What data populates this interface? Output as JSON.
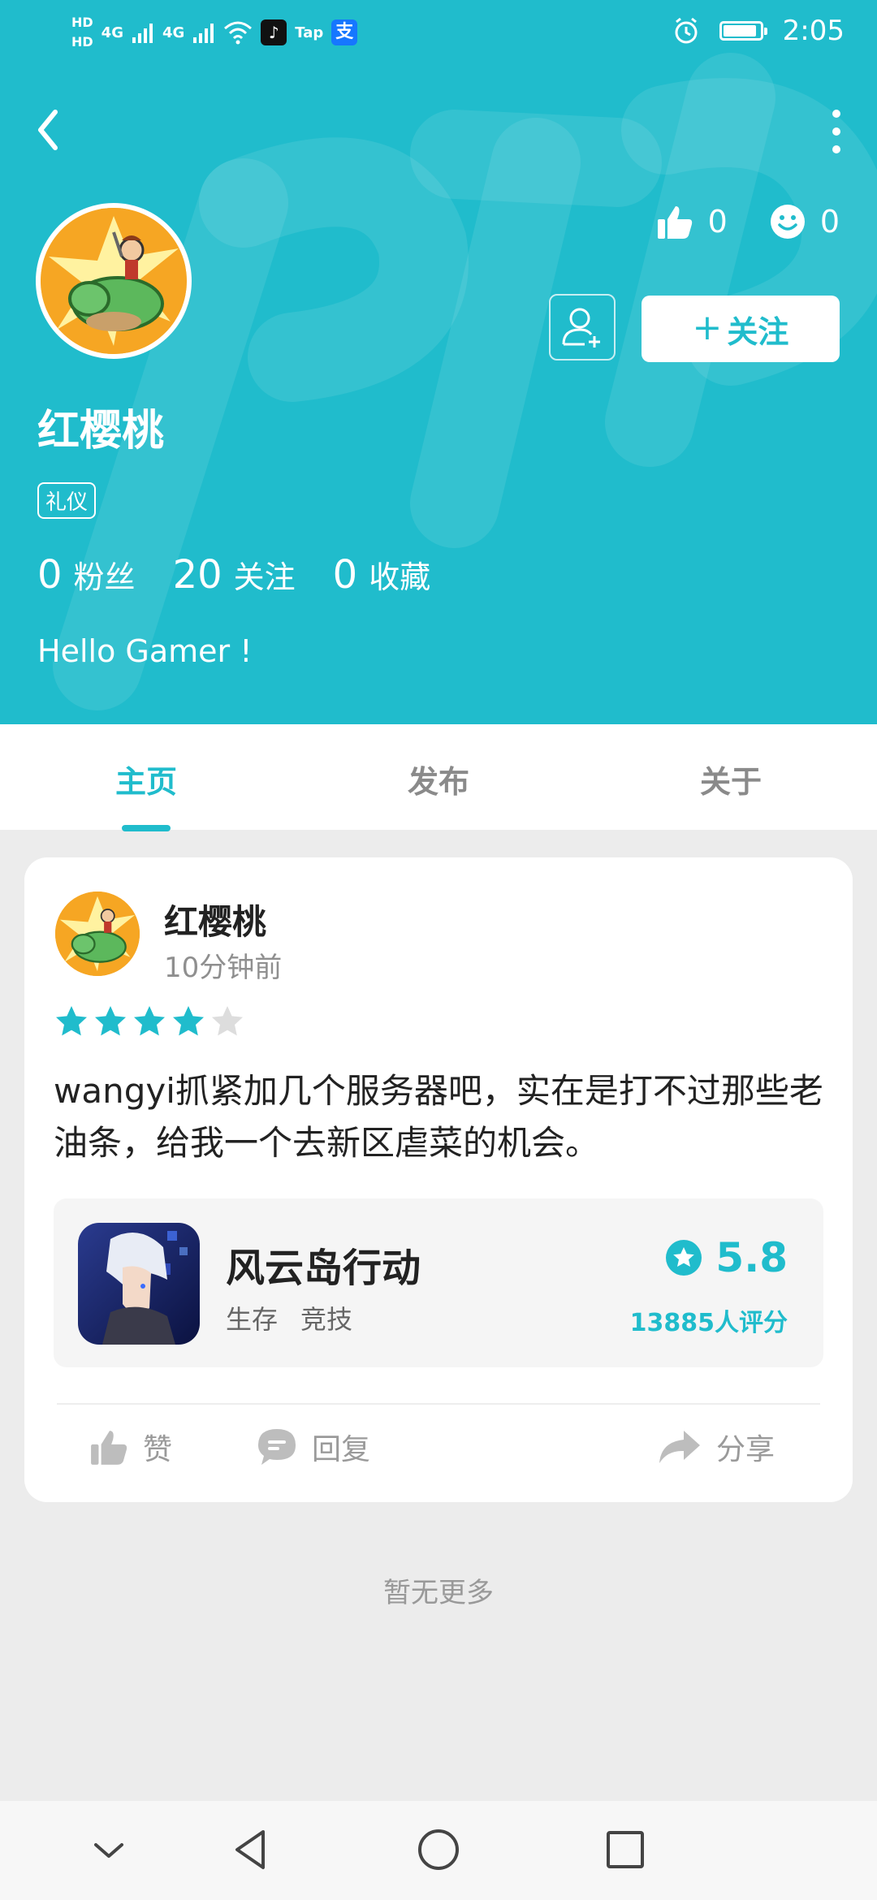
{
  "status_bar": {
    "hd1": "HD",
    "hd2": "HD",
    "net1": "4G",
    "net2": "4G",
    "tap": "Tap",
    "alipay": "支",
    "time": "2:05",
    "battery_level": 0.92
  },
  "profile": {
    "likes_count": "0",
    "smile_count": "0",
    "follow_button": "关注",
    "name": "红樱桃",
    "tag": "礼仪",
    "stats": [
      {
        "num": "0",
        "label": "粉丝"
      },
      {
        "num": "20",
        "label": "关注"
      },
      {
        "num": "0",
        "label": "收藏"
      }
    ],
    "bio": "Hello Gamer !"
  },
  "tabs": [
    {
      "label": "主页",
      "active": true
    },
    {
      "label": "发布",
      "active": false
    },
    {
      "label": "关于",
      "active": false
    }
  ],
  "post": {
    "author": "红樱桃",
    "time": "10分钟前",
    "rating": 4,
    "rating_max": 5,
    "text": "wangyi抓紧加几个服务器吧，实在是打不过那些老油条，给我一个去新区虐菜的机会。",
    "game": {
      "title": "风云岛行动",
      "tags": [
        "生存",
        "竞技"
      ],
      "score": "5.8",
      "ratings": "13885人评分"
    },
    "actions": {
      "like": "赞",
      "reply": "回复",
      "share": "分享"
    }
  },
  "footer_text": "暂无更多",
  "colors": {
    "accent": "#20bccc",
    "star_off": "#dddddd"
  },
  "icons": [
    "back-icon",
    "more-icon",
    "thumb-up-icon",
    "smile-icon",
    "add-friend-icon",
    "star-badge-icon",
    "comment-icon",
    "share-icon"
  ]
}
